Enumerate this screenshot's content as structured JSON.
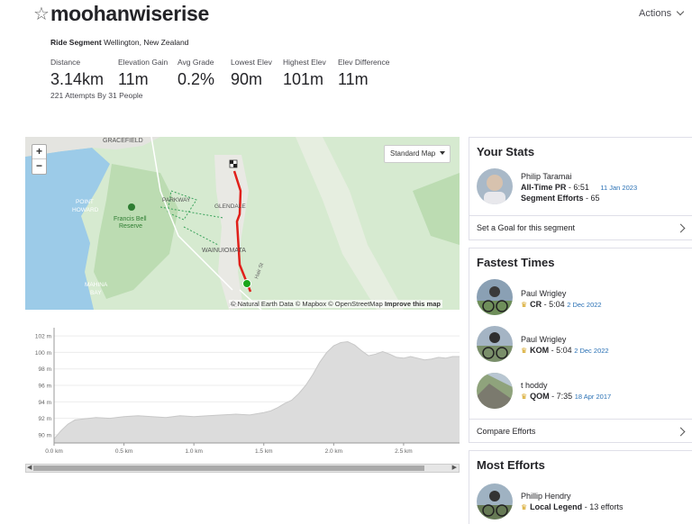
{
  "header": {
    "title": "moohanwiserise",
    "actions_label": "Actions",
    "segment_type": "Ride Segment",
    "location": "Wellington, New Zealand"
  },
  "stats": [
    {
      "label": "Distance",
      "value": "3.14km"
    },
    {
      "label": "Elevation Gain",
      "value": "11m"
    },
    {
      "label": "Avg Grade",
      "value": "0.2%"
    },
    {
      "label": "Lowest Elev",
      "value": "90m"
    },
    {
      "label": "Highest Elev",
      "value": "101m"
    },
    {
      "label": "Elev Difference",
      "value": "11m"
    }
  ],
  "attempts": "221 Attempts By 31 People",
  "map": {
    "zoom_in": "+",
    "zoom_out": "−",
    "map_type": "Standard Map",
    "labels": [
      "GRACEFIELD",
      "POINT",
      "HOWARD",
      "Francis Bell",
      "Reserve",
      "PARKWAY",
      "GLENDALE",
      "WAINUIOMATA",
      "MAHINA",
      "BAY",
      "Hair St",
      "HO"
    ],
    "attribution": "© Natural Earth Data © Mapbox © OpenStreetMap",
    "improve": "Improve this map"
  },
  "chart_data": {
    "type": "area",
    "xlabel": "",
    "ylabel": "",
    "x_ticks": [
      "0.0 km",
      "0.5 km",
      "1.0 km",
      "1.5 km",
      "2.0 km",
      "2.5 km"
    ],
    "y_ticks": [
      "90 m",
      "92 m",
      "94 m",
      "96 m",
      "98 m",
      "100 m",
      "102 m"
    ],
    "xlim": [
      0,
      2.9
    ],
    "ylim": [
      89,
      103
    ],
    "x": [
      0,
      0.05,
      0.1,
      0.15,
      0.2,
      0.25,
      0.3,
      0.4,
      0.5,
      0.6,
      0.7,
      0.8,
      0.9,
      1.0,
      1.1,
      1.2,
      1.3,
      1.4,
      1.5,
      1.55,
      1.6,
      1.65,
      1.7,
      1.75,
      1.8,
      1.85,
      1.9,
      1.95,
      2.0,
      2.05,
      2.1,
      2.15,
      2.2,
      2.25,
      2.3,
      2.35,
      2.4,
      2.45,
      2.5,
      2.55,
      2.6,
      2.65,
      2.7,
      2.75,
      2.8,
      2.85,
      2.9
    ],
    "y": [
      89.5,
      90.5,
      91.3,
      91.8,
      91.9,
      92.0,
      92.1,
      92.0,
      92.2,
      92.3,
      92.2,
      92.1,
      92.3,
      92.2,
      92.3,
      92.4,
      92.5,
      92.4,
      92.7,
      92.9,
      93.3,
      93.8,
      94.2,
      95.0,
      96.0,
      97.3,
      98.8,
      100.0,
      100.8,
      101.2,
      101.3,
      100.9,
      100.2,
      99.6,
      99.8,
      100.1,
      99.8,
      99.4,
      99.3,
      99.5,
      99.3,
      99.1,
      99.2,
      99.4,
      99.3,
      99.5,
      99.5
    ]
  },
  "your_stats": {
    "title": "Your Stats",
    "name": "Philip Taramai",
    "pr_label": "All-Time PR",
    "pr_value": "6:51",
    "pr_date": "11 Jan 2023",
    "efforts_label": "Segment Efforts",
    "efforts_value": "65",
    "goal_link": "Set a Goal for this segment"
  },
  "fastest": {
    "title": "Fastest Times",
    "entries": [
      {
        "name": "Paul Wrigley",
        "badge": "CR",
        "time": "5:04",
        "date": "2 Dec 2022"
      },
      {
        "name": "Paul Wrigley",
        "badge": "KOM",
        "time": "5:04",
        "date": "2 Dec 2022"
      },
      {
        "name": "t hoddy",
        "badge": "QOM",
        "time": "7:35",
        "date": "18 Apr 2017"
      }
    ],
    "compare_link": "Compare Efforts"
  },
  "most_efforts": {
    "title": "Most Efforts",
    "name": "Phillip Hendry",
    "badge": "Local Legend",
    "value": "13 efforts"
  },
  "colors": {
    "route": "#e0201b",
    "start": "#19a619",
    "link": "#2a71b5",
    "crown": "#d4a017",
    "map_green": "#cfe6c8",
    "water": "#9ccbe8"
  }
}
